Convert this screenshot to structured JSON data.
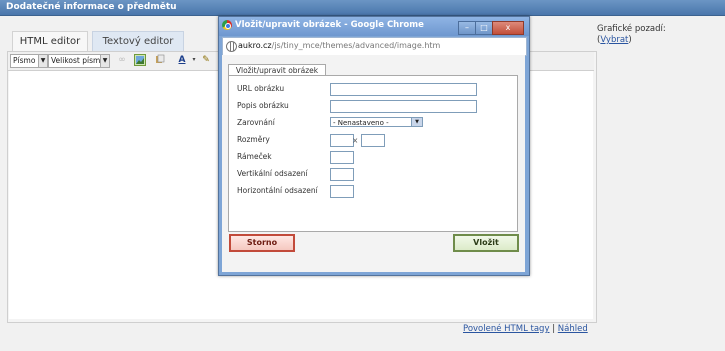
{
  "page": {
    "header_title": "Dodatečné informace o předmětu",
    "tabs": [
      "HTML editor",
      "Textový editor"
    ],
    "right_panel": {
      "label": "Grafické pozadí:",
      "link_prefix": "(",
      "link": "Vybrat",
      "link_suffix": ")"
    },
    "footer": {
      "link_html_tags": "Povolené HTML tagy",
      "separator": "|",
      "link_preview": "Náhled"
    }
  },
  "toolbar": {
    "font_select": "Písmo",
    "size_select": "Velikost písma",
    "icons": [
      "link-icon",
      "image-icon",
      "paste-icon",
      "text-color-icon",
      "highlight-icon"
    ]
  },
  "popup": {
    "title": "Vložit/upravit obrázek - Google Chrome",
    "url_host": "aukro.cz",
    "url_path": "/js/tiny_mce/themes/advanced/image.htm",
    "tab": "Vložit/upravit obrázek",
    "fields": {
      "url_label": "URL obrázku",
      "url_value": "",
      "desc_label": "Popis obrázku",
      "desc_value": "",
      "align_label": "Zarovnání",
      "align_value": "- Nenastaveno -",
      "size_label": "Rozměry",
      "size_sep": "×",
      "border_label": "Rámeček",
      "vspace_label": "Vertikální odsazení",
      "hspace_label": "Horizontální odsazení"
    },
    "buttons": {
      "cancel": "Storno",
      "insert": "Vložit"
    },
    "window_buttons": {
      "minimize": "–",
      "maximize": "□",
      "close": "x"
    }
  }
}
